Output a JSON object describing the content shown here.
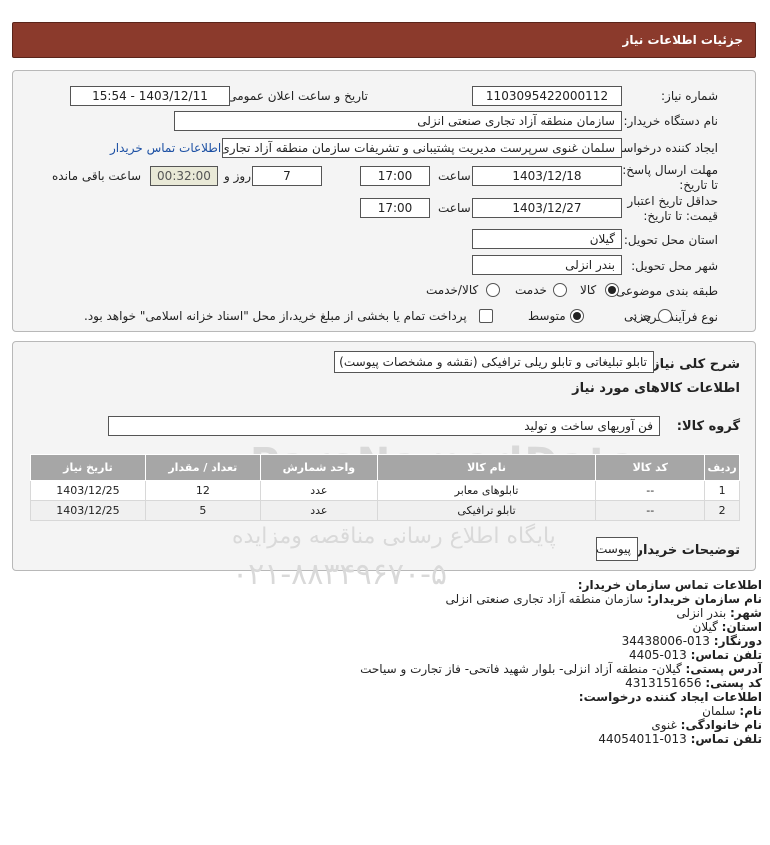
{
  "header": {
    "title": "جزئیات اطلاعات نیاز"
  },
  "need": {
    "need_number_label": "شماره نیاز:",
    "need_number": "1103095422000112",
    "announce_label": "تاریخ و ساعت اعلان عمومی:",
    "announce_value": "1403/12/11 - 15:54",
    "buyer_org_label": "نام دستگاه خریدار:",
    "buyer_org": "سازمان منطقه آزاد تجاری  صنعتی انزلی",
    "creator_label": "ایجاد کننده درخواست:",
    "creator": "سلمان غنوی سرپرست مدیریت پشتیبانی و تشریفات سازمان منطقه آزاد تجاری",
    "contact_link": "اطلاعات تماس خریدار",
    "deadline_label": "مهلت ارسال پاسخ: تا تاریخ:",
    "deadline_date": "1403/12/18",
    "time_label": "ساعت",
    "deadline_time": "17:00",
    "days": "7",
    "days_label": "روز و",
    "remaining": "00:32:00",
    "remaining_label": "ساعت باقی مانده",
    "validity_label": "حداقل تاریخ اعتبار قیمت: تا تاریخ:",
    "validity_date": "1403/12/27",
    "validity_time": "17:00",
    "province_label": "استان محل تحویل:",
    "province": "گیلان",
    "city_label": "شهر محل تحویل:",
    "city": "بندر انزلی",
    "category_label": "طبقه بندی موضوعی:",
    "category_options": [
      "کالا",
      "خدمت",
      "کالا/خدمت"
    ],
    "process_label": "نوع فرآیند خرید :",
    "process_options": [
      "جزیی",
      "متوسط"
    ],
    "payment_note": "پرداخت تمام یا بخشی از مبلغ خرید،از محل \"اسناد خزانه اسلامی\" خواهد بود."
  },
  "description": {
    "label": "شرح کلی نیاز:",
    "value": "تابلو تبلیغاتی و تابلو ریلی ترافیکی (نقشه و مشخصات پیوست)",
    "goods_title": "اطلاعات کالاهای مورد نیاز",
    "group_label": "گروه کالا:",
    "group_value": "فن آوریهای ساخت و تولید"
  },
  "table": {
    "headers": [
      "ردیف",
      "کد کالا",
      "نام کالا",
      "واحد شمارش",
      "تعداد / مقدار",
      "تاریخ نیاز"
    ],
    "rows": [
      [
        "1",
        "--",
        "تابلوهای معابر",
        "عدد",
        "12",
        "1403/12/25"
      ],
      [
        "2",
        "--",
        "تابلو ترافیکی",
        "عدد",
        "5",
        "1403/12/25"
      ]
    ]
  },
  "buyer_notes": {
    "label": "توضیحات خریدار:",
    "value": "پیوست"
  },
  "watermark": {
    "line1": "ParsNamadData",
    "line2": "مرکز فرآیند اطلاعات پارس نماد داده ها",
    "line3": "پایگاه اطلاع رسانی مناقصه ومزایده",
    "line4": "۰۲۱-۸۸۳۴۹۶۷۰-۵"
  },
  "contact": {
    "title": "اطلاعات تماس سازمان خریدار:",
    "buyer_name_k": "نام سازمان خریدار:",
    "buyer_name_v": "سازمان منطقه آزاد تجاری صنعتی انزلی",
    "city_k": "شهر:",
    "city_v": "بندر انزلی",
    "province_k": "استان:",
    "province_v": "گیلان",
    "fax_k": "دورنگار:",
    "fax_v": "013-34438006",
    "phone_k": "تلفن تماس:",
    "phone_v": "013-4405",
    "address_k": "آدرس پستی:",
    "address_v": "گیلان- منطقه آزاد انزلی- بلوار شهید فاتحی- فاز تجارت و سیاحت",
    "postal_k": "کد پستی:",
    "postal_v": "4313151656",
    "creator_title": "اطلاعات ایجاد کننده درخواست:",
    "first_k": "نام:",
    "first_v": "سلمان",
    "last_k": "نام خانوادگی:",
    "last_v": "غنوی",
    "cphone_k": "تلفن تماس:",
    "cphone_v": "013-44054011"
  }
}
